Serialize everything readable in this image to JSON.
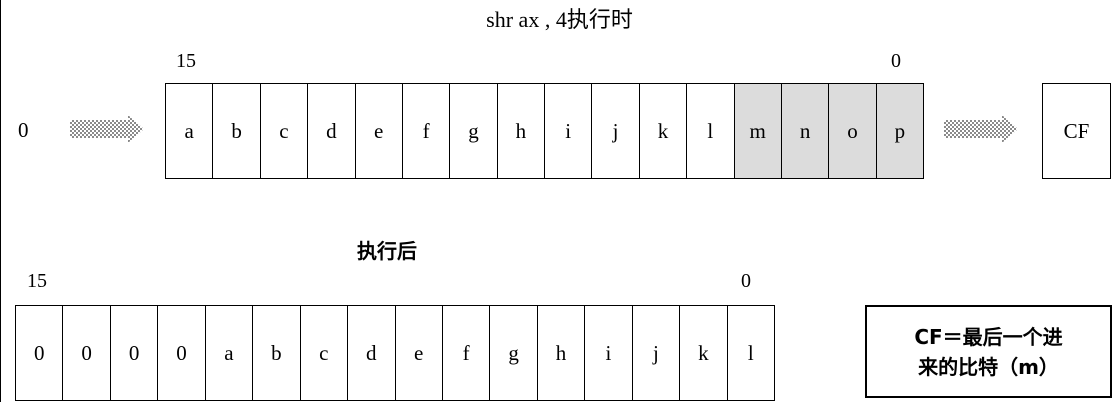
{
  "title": "shr  ax , 4执行时",
  "before": {
    "bit_high": "15",
    "bit_low": "0",
    "input": "0",
    "cells": [
      "a",
      "b",
      "c",
      "d",
      "e",
      "f",
      "g",
      "h",
      "i",
      "j",
      "k",
      "l",
      "m",
      "n",
      "o",
      "p"
    ],
    "shaded": [
      12,
      13,
      14,
      15
    ],
    "cf_label": "CF"
  },
  "after": {
    "label": "执行后",
    "bit_high": "15",
    "bit_low": "0",
    "cells": [
      "0",
      "0",
      "0",
      "0",
      "a",
      "b",
      "c",
      "d",
      "e",
      "f",
      "g",
      "h",
      "i",
      "j",
      "k",
      "l"
    ]
  },
  "note": {
    "line1": "CF＝最后一个进",
    "line2": "来的比特（m）"
  },
  "colors": {
    "shaded": "#dcdcdc",
    "border": "#000000"
  }
}
